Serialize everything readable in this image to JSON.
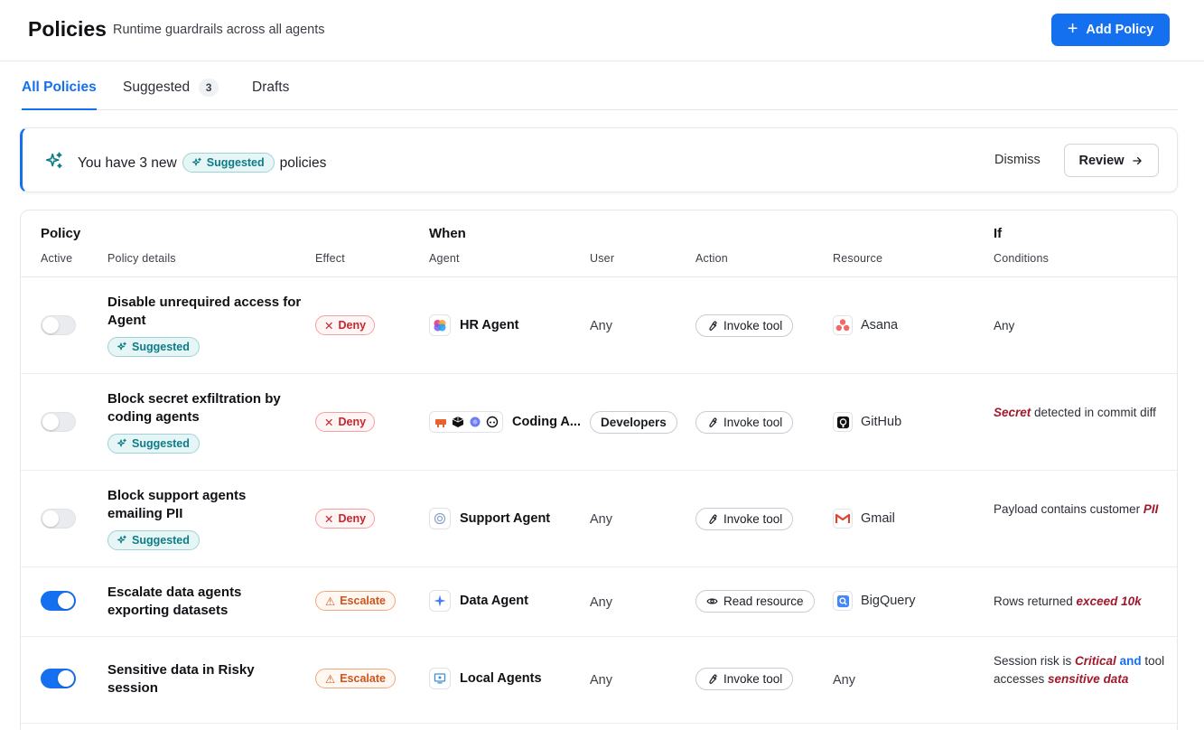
{
  "header": {
    "title": "Policies",
    "subtitle": "Runtime guardrails across all agents",
    "add_button": "Add Policy"
  },
  "tabs": [
    {
      "label": "All Policies",
      "active": true
    },
    {
      "label": "Suggested",
      "count": "3"
    },
    {
      "label": "Drafts"
    }
  ],
  "banner": {
    "prefix": "You have 3 new",
    "pill": "Suggested",
    "suffix": "policies",
    "dismiss": "Dismiss",
    "review": "Review"
  },
  "table": {
    "groups": {
      "policy": "Policy",
      "when": "When",
      "if": "If"
    },
    "columns": {
      "active": "Active",
      "details": "Policy details",
      "effect": "Effect",
      "agent": "Agent",
      "user": "User",
      "action": "Action",
      "resource": "Resource",
      "conditions": "Conditions"
    },
    "rows": [
      {
        "active": false,
        "name": "Disable unrequired access for Agent",
        "badge": "Suggested",
        "effect": "Deny",
        "agent": "HR Agent",
        "user": "Any",
        "action": "Invoke tool",
        "resource": "Asana",
        "condition": {
          "text": "Any"
        }
      },
      {
        "active": false,
        "name": "Block secret exfiltration by coding agents",
        "badge": "Suggested",
        "effect": "Deny",
        "agent": "Coding A...",
        "user": "Developers",
        "action": "Invoke tool",
        "resource": "GitHub",
        "condition": {
          "em": "Secret",
          "text": " detected in commit diff"
        }
      },
      {
        "active": false,
        "name": "Block support agents emailing PII",
        "badge": "Suggested",
        "effect": "Deny",
        "agent": "Support Agent",
        "user": "Any",
        "action": "Invoke tool",
        "resource": "Gmail",
        "condition": {
          "text": "Payload contains customer ",
          "em": "PII"
        }
      },
      {
        "active": true,
        "name": "Escalate data agents exporting datasets",
        "effect": "Escalate",
        "agent": "Data Agent",
        "user": "Any",
        "action": "Read resource",
        "resource": "BigQuery",
        "condition": {
          "text": "Rows returned ",
          "em": "exceed 10k"
        }
      },
      {
        "active": true,
        "name": "Sensitive data in Risky session",
        "effect": "Escalate",
        "agent": "Local Agents",
        "user": "Any",
        "action": "Invoke tool",
        "resource": "Any",
        "condition": {
          "t1": "Session risk is ",
          "em1": "Critical",
          "and": " and",
          "t2": " tool accesses ",
          "em2": "sensitive data"
        }
      }
    ]
  },
  "colors": {
    "accent": "#1570ef",
    "deny": "#c4262b",
    "escalate": "#d0541b",
    "suggested": "#0e7c86",
    "condition_emphasis": "#9e1a2c"
  }
}
